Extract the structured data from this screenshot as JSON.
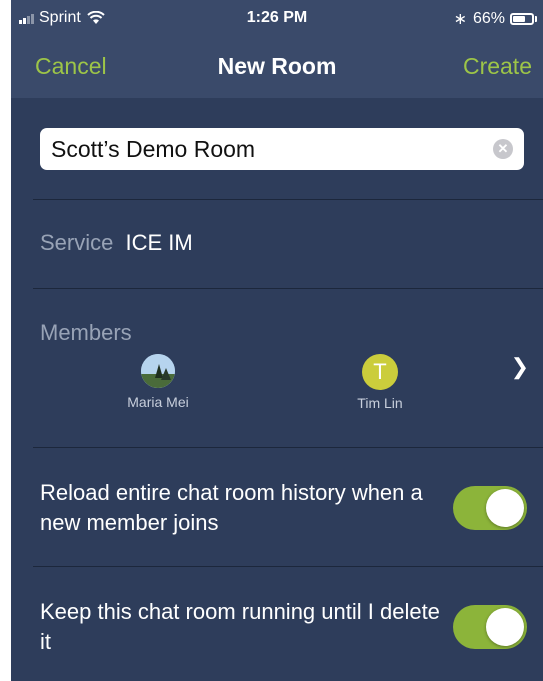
{
  "status_bar": {
    "carrier": "Sprint",
    "time": "1:26 PM",
    "battery_percent": "66%",
    "battery_level": 0.66,
    "icons": [
      "signal-icon",
      "wifi-icon",
      "bluetooth-icon",
      "battery-icon"
    ]
  },
  "nav": {
    "cancel_label": "Cancel",
    "title": "New Room",
    "create_label": "Create",
    "accent_color": "#9dc548"
  },
  "room_name": {
    "value": "Scott’s Demo Room",
    "clear_icon": "clear-icon"
  },
  "service": {
    "label": "Service",
    "value": "ICE IM"
  },
  "members": {
    "label": "Members",
    "list": [
      {
        "name": "Maria Mei",
        "avatar": "photo"
      },
      {
        "name": "Tim Lin",
        "avatar_initial": "T"
      }
    ],
    "chevron_icon": "chevron-right-icon"
  },
  "settings": {
    "reload_history": {
      "text": "Reload entire chat room history when a new member joins",
      "enabled": true
    },
    "keep_running": {
      "text": "Keep this chat room running until I delete it",
      "enabled": true
    }
  },
  "colors": {
    "background": "#2e3d5b",
    "navbar": "#3a4a6a",
    "toggle_on": "#8cb43a"
  }
}
